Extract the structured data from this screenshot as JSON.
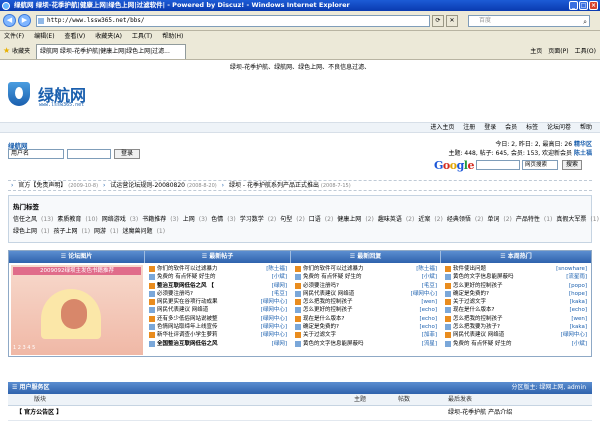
{
  "window": {
    "title": "绿航网 绿坝-花季护航|健康上网|绿色上网|过滤软件| - Powered by Discuz! - Windows Internet Explorer"
  },
  "address": {
    "url": "http://www.lssw365.net/bbs/",
    "search_placeholder": "百度"
  },
  "menu": [
    "文件(F)",
    "编辑(E)",
    "查看(V)",
    "收藏夹(A)",
    "工具(T)",
    "帮助(H)"
  ],
  "favbar": {
    "fav_label": "收藏夹",
    "tab_label": "绿航网 绿坝-花季护航|健康上网|绿色上网|过滤...",
    "tools": [
      "主页",
      "页面(P)",
      "工具(O)"
    ]
  },
  "forum": {
    "slogan": "绿坝-花季护航、绿航网、绿色上网、不良信息过滤、",
    "logo_name": "绿航网",
    "logo_url": "www.lssw365.net",
    "topnav": [
      "进入主页",
      "注册",
      "登录",
      "会员",
      "标签",
      "论坛问卷",
      "帮助"
    ],
    "site_title": "绿航网",
    "login_placeholder": "用户名",
    "login_button": "登录",
    "stats_line1": "今日: 2, 昨日: 2, 最高日: 26",
    "stats_link1": "精华区",
    "stats_line2": "主题: 448, 帖子: 645, 会员: 153, 欢迎新会员",
    "stats_member": "陈土福",
    "google_select": "网页搜索",
    "google_button": "搜索"
  },
  "news": [
    {
      "title": "官方【免责声明】",
      "date": "(2009-10-8)"
    },
    {
      "title": "试运营论坛规则-20080820",
      "date": "(2008-8-20)"
    },
    {
      "title": "绿坝 - 花季护航系列产品正式推出",
      "date": "(2008-7-15)"
    }
  ],
  "tags": {
    "heading": "热门标签",
    "row1": [
      {
        "name": "信任之风",
        "count": "(13)"
      },
      {
        "name": "素质教育",
        "count": "(10)"
      },
      {
        "name": "网络游戏",
        "count": "(3)"
      },
      {
        "name": "书籍推荐",
        "count": "(3)"
      },
      {
        "name": "上网",
        "count": "(3)"
      },
      {
        "name": "色情",
        "count": "(3)"
      },
      {
        "name": "学习数学",
        "count": "(2)"
      },
      {
        "name": "句型",
        "count": "(2)"
      },
      {
        "name": "口语",
        "count": "(2)"
      },
      {
        "name": "健康上网",
        "count": "(2)"
      },
      {
        "name": "趣味英语",
        "count": "(2)"
      },
      {
        "name": "近案",
        "count": "(2)"
      },
      {
        "name": "经典领悟",
        "count": "(2)"
      },
      {
        "name": "单词",
        "count": "(2)"
      },
      {
        "name": "产品特性",
        "count": "(1)"
      },
      {
        "name": "真假大军票",
        "count": "(1)"
      }
    ],
    "row2": [
      {
        "name": "绿色上网",
        "count": "(1)"
      },
      {
        "name": "孩子上网",
        "count": "(1)"
      },
      {
        "name": "网游",
        "count": "(1)"
      },
      {
        "name": "迷魔兽问题",
        "count": "(1)"
      }
    ]
  },
  "panel": {
    "heads": [
      "论坛图片",
      "最新帖子",
      "最新回复",
      "本周热门"
    ],
    "photo_title": "2009092绿坝主发色书籍推荐",
    "photo_pager": "1 2 3 4 5",
    "new_posts": [
      {
        "t": "你们的软件可以过滤暴力",
        "a": "[陈土福]"
      },
      {
        "t": "免费的 有点怀疑 好生的",
        "a": "[小斌]"
      },
      {
        "t": "整治互联网低俗之风 【",
        "a": "[绿网]"
      },
      {
        "t": "必须要注册吗?",
        "a": "[毛豆]"
      },
      {
        "t": "网民更实在谷项行动成果",
        "a": "[绿网中心]"
      },
      {
        "t": "网民代表建议  网络道",
        "a": "[绿网中心]"
      },
      {
        "t": "还有多少低俗网站说被整",
        "a": "[绿网中心]"
      },
      {
        "t": "色情网站取缔年上线宣传",
        "a": "[绿网中心]"
      },
      {
        "t": "新华社评调查小学生萝莉",
        "a": "[绿网中心]"
      },
      {
        "t": "全国整治互联网低俗之风",
        "a": "[绿网]"
      }
    ],
    "new_replies": [
      {
        "t": "你们的软件可以过滤暴力",
        "a": "[陈土福]"
      },
      {
        "t": "免费的 有点怀疑 好生的",
        "a": "[小斌]"
      },
      {
        "t": "必须要注册吗?",
        "a": "[毛豆]"
      },
      {
        "t": "网民代表建议  网络道",
        "a": "[绿网中心]"
      },
      {
        "t": "怎么把我的控制孩子",
        "a": "[wen]"
      },
      {
        "t": "怎么更好的控制孩子",
        "a": "[echo]"
      },
      {
        "t": "现在是什么版本?",
        "a": "[echo]"
      },
      {
        "t": "确定是免费的?",
        "a": "[echo]"
      },
      {
        "t": "关于过滤文字",
        "a": "[加菲]"
      },
      {
        "t": "黄色的文字信息能屏蔽吗",
        "a": "[流星]"
      }
    ],
    "hot": [
      {
        "t": "软件使出问题",
        "a": "[snowhare]"
      },
      {
        "t": "黄色的文字信息能屏蔽吗",
        "a": "[流星雨]"
      },
      {
        "t": "怎么更好的控制孩子",
        "a": "[popo]"
      },
      {
        "t": "确定是免费的?",
        "a": "[hope]"
      },
      {
        "t": "关于过滤文字",
        "a": "[kaka]"
      },
      {
        "t": "现在是什么版本?",
        "a": "[echo]"
      },
      {
        "t": "怎么把我的控制孩子",
        "a": "[wen]"
      },
      {
        "t": "怎么把我要为孩子?",
        "a": "[kaka]"
      },
      {
        "t": "网民代表建议 网络道",
        "a": "[绿网中心]"
      },
      {
        "t": "免费的 有点怀疑 好生的",
        "a": "[小斌]"
      }
    ]
  },
  "category": {
    "title": "用户服务区",
    "moderators": "分区版主: 绿网上网, admin",
    "col_forum": "版块",
    "col_threads": "主题",
    "col_posts": "帖数",
    "col_last": "最后发表",
    "row_name": "【 官方公告区 】",
    "row_last": "绿坝-花季护航 产品介绍"
  }
}
